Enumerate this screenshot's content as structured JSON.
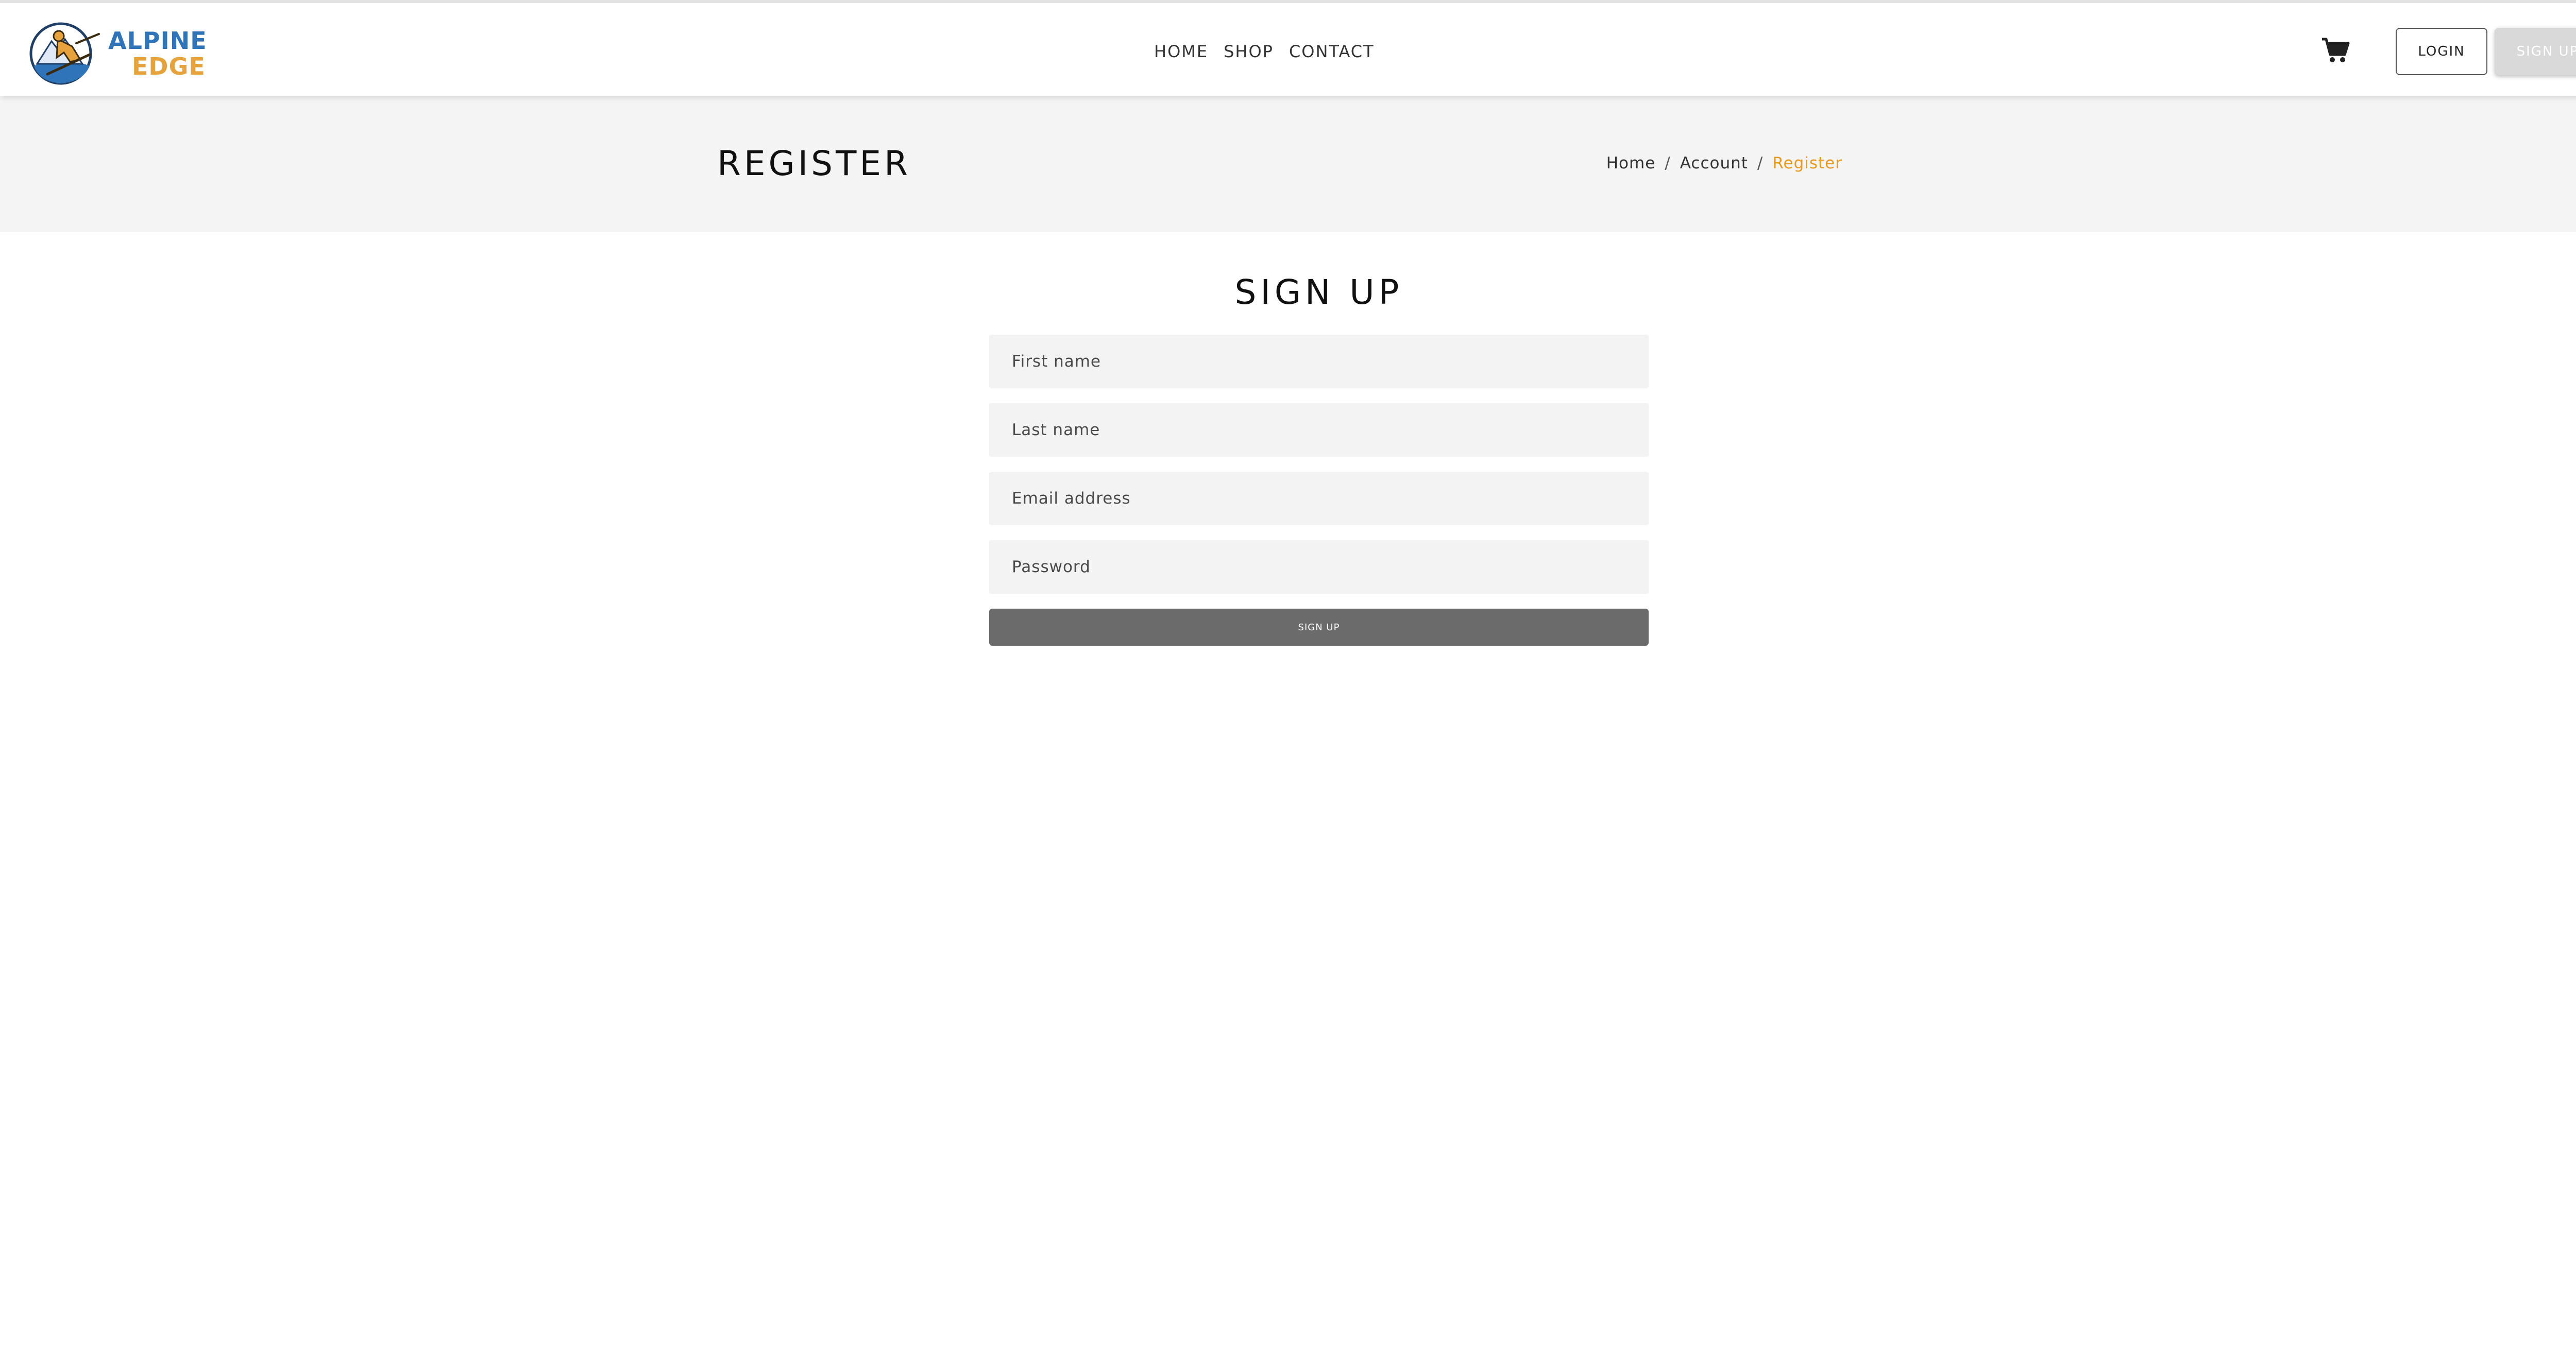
{
  "brand": {
    "logo_line1": "ALPINE",
    "logo_line2": "EDGE",
    "colors": {
      "blue": "#2f73b8",
      "orange": "#e6a23c"
    }
  },
  "nav": {
    "items": [
      {
        "label": "HOME"
      },
      {
        "label": "SHOP"
      },
      {
        "label": "CONTACT"
      }
    ]
  },
  "header_actions": {
    "cart_icon": "shopping-cart-icon",
    "login_label": "LOGIN",
    "signup_label": "SIGN UP"
  },
  "page": {
    "title": "REGISTER",
    "breadcrumb": [
      {
        "label": "Home"
      },
      {
        "label": "Account"
      },
      {
        "label": "Register"
      }
    ],
    "breadcrumb_separator": "/",
    "active_color": "#e69a1f"
  },
  "form": {
    "heading": "SIGN UP",
    "first_name": {
      "placeholder": "First name",
      "value": ""
    },
    "last_name": {
      "placeholder": "Last name",
      "value": ""
    },
    "email": {
      "placeholder": "Email address",
      "value": ""
    },
    "password": {
      "placeholder": "Password",
      "value": ""
    },
    "submit_label": "SIGN UP"
  }
}
